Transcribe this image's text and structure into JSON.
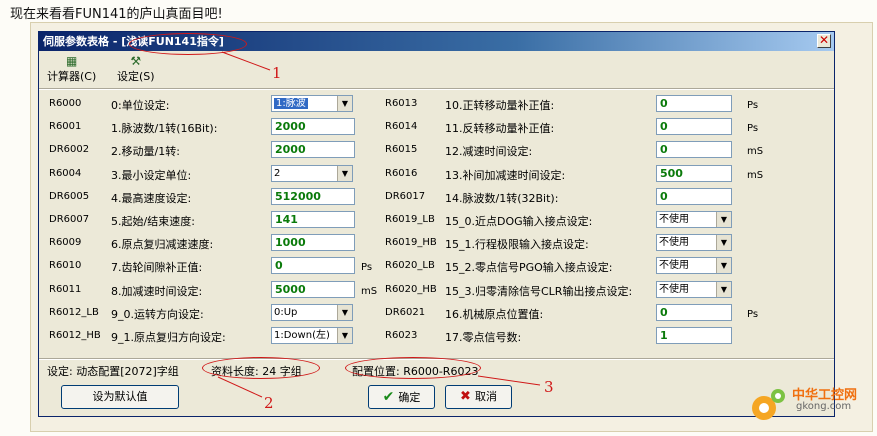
{
  "caption": "现在来看看FUN141的庐山真面目吧!",
  "window": {
    "title": "伺服参数表格 - [浅读FUN141指令]"
  },
  "toolbar": {
    "calc": "计算器(C)",
    "settings": "设定(S)"
  },
  "rows_left": [
    {
      "reg": "R6000",
      "label": "0:单位设定:",
      "type": "select",
      "value": "1:脉波",
      "highlight": true,
      "unit": ""
    },
    {
      "reg": "R6001",
      "label": "1.脉波数/1转(16Bit):",
      "type": "input",
      "value": "2000",
      "unit": ""
    },
    {
      "reg": "DR6002",
      "label": "2.移动量/1转:",
      "type": "input",
      "value": "2000",
      "unit": ""
    },
    {
      "reg": "R6004",
      "label": "3.最小设定单位:",
      "type": "select",
      "value": "2",
      "highlight": false,
      "unit": ""
    },
    {
      "reg": "DR6005",
      "label": "4.最高速度设定:",
      "type": "input",
      "value": "512000",
      "unit": ""
    },
    {
      "reg": "DR6007",
      "label": "5.起始/结束速度:",
      "type": "input",
      "value": "141",
      "unit": ""
    },
    {
      "reg": "R6009",
      "label": "6.原点复归减速速度:",
      "type": "input",
      "value": "1000",
      "unit": ""
    },
    {
      "reg": "R6010",
      "label": "7.齿轮间隙补正值:",
      "type": "input",
      "value": "0",
      "unit": "Ps"
    },
    {
      "reg": "R6011",
      "label": "8.加减速时间设定:",
      "type": "input",
      "value": "5000",
      "unit": "mS"
    },
    {
      "reg": "R6012_LB",
      "label": "9_0.运转方向设定:",
      "type": "select",
      "value": "0:Up",
      "highlight": false,
      "unit": ""
    },
    {
      "reg": "R6012_HB",
      "label": "9_1.原点复归方向设定:",
      "type": "select",
      "value": "1:Down(左)",
      "highlight": false,
      "unit": ""
    }
  ],
  "rows_right": [
    {
      "reg": "R6013",
      "label": "10.正转移动量补正值:",
      "type": "input",
      "value": "0",
      "unit": "Ps"
    },
    {
      "reg": "R6014",
      "label": "11.反转移动量补正值:",
      "type": "input",
      "value": "0",
      "unit": "Ps"
    },
    {
      "reg": "R6015",
      "label": "12.减速时间设定:",
      "type": "input",
      "value": "0",
      "unit": "mS"
    },
    {
      "reg": "R6016",
      "label": "13.补间加减速时间设定:",
      "type": "input",
      "value": "500",
      "unit": "mS"
    },
    {
      "reg": "DR6017",
      "label": "14.脉波数/1转(32Bit):",
      "type": "input",
      "value": "0",
      "unit": ""
    },
    {
      "reg": "R6019_LB",
      "label": "15_0.近点DOG输入接点设定:",
      "type": "select",
      "value": "不使用",
      "highlight": false,
      "unit": ""
    },
    {
      "reg": "R6019_HB",
      "label": "15_1.行程极限输入接点设定:",
      "type": "select",
      "value": "不使用",
      "highlight": false,
      "unit": ""
    },
    {
      "reg": "R6020_LB",
      "label": "15_2.零点信号PGO输入接点设定:",
      "type": "select",
      "value": "不使用",
      "highlight": false,
      "unit": ""
    },
    {
      "reg": "R6020_HB",
      "label": "15_3.归零清除信号CLR输出接点设定:",
      "type": "select",
      "value": "不使用",
      "highlight": false,
      "unit": ""
    },
    {
      "reg": "DR6021",
      "label": "16.机械原点位置值:",
      "type": "input",
      "value": "0",
      "unit": "Ps"
    },
    {
      "reg": "R6023",
      "label": "17.零点信号数:",
      "type": "input",
      "value": "1",
      "unit": ""
    }
  ],
  "status": {
    "setting": "设定: 动态配置[2072]字组",
    "length": "资料长度: 24 字组",
    "position": "配置位置: R6000-R6023"
  },
  "buttons": {
    "default": "设为默认值",
    "ok": "确定",
    "cancel": "取消"
  },
  "annotations": [
    "1",
    "2",
    "3"
  ],
  "watermark": {
    "name": "中华工控网",
    "url": "gkong.com"
  },
  "colors": {
    "title_bar": "#0a246a",
    "value_text": "#0a7a0a",
    "annotation": "#d01818",
    "dialog_bg": "#ece9d8"
  }
}
